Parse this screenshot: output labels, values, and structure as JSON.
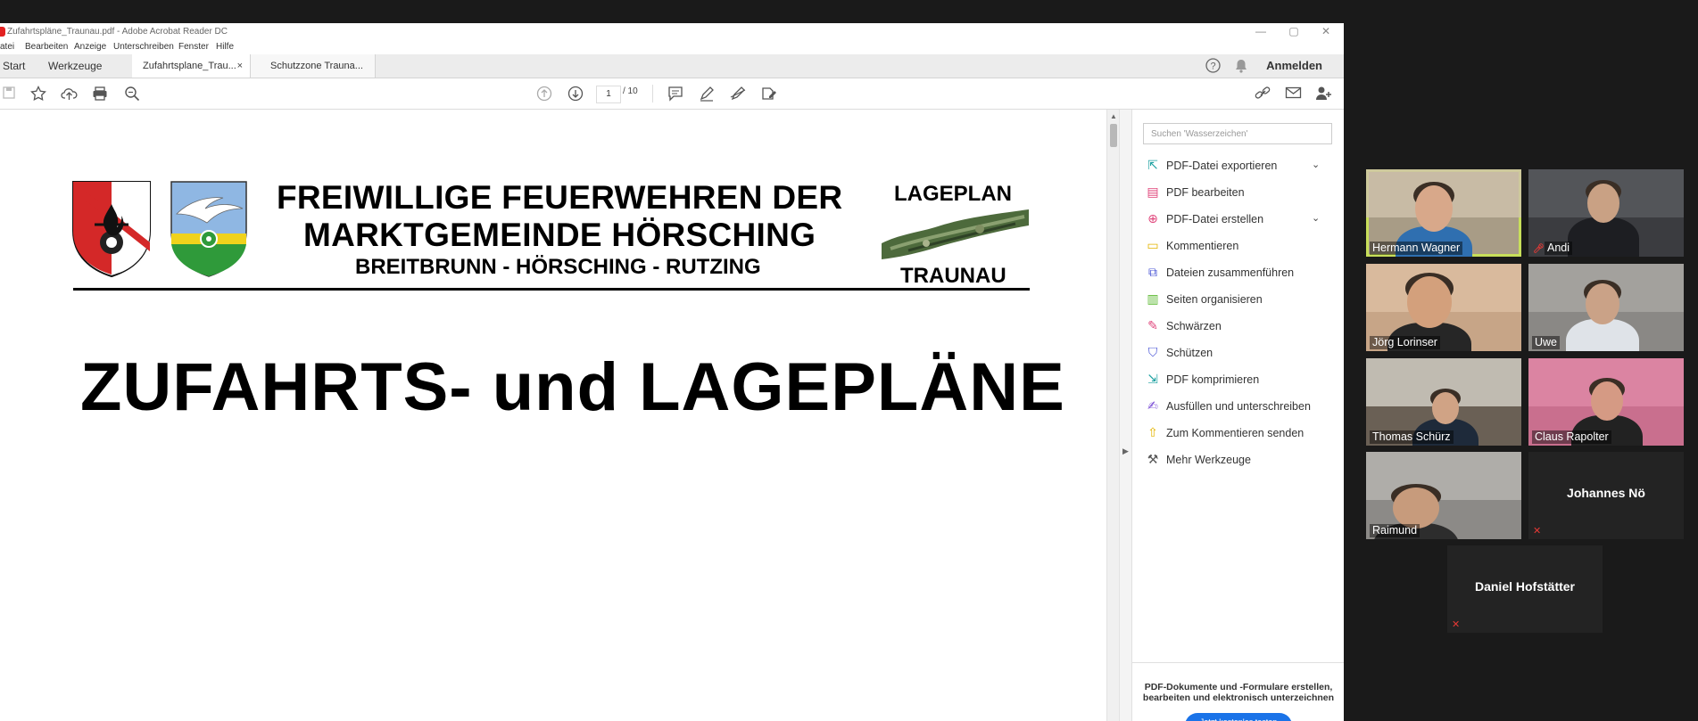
{
  "window": {
    "title": "Zufahrtspläne_Traunau.pdf - Adobe Acrobat Reader DC",
    "minimize": "—",
    "maximize": "▢",
    "close": "✕"
  },
  "menu": [
    "atei",
    "Bearbeiten",
    "Anzeige",
    "Unterschreiben",
    "Fenster",
    "Hilfe"
  ],
  "tabs": {
    "start": "Start",
    "werkzeuge": "Werkzeuge",
    "doc1": "Zufahrtsplane_Trau...",
    "doc2": "Schutzzone Trauna...",
    "close_glyph": "×",
    "sign_in": "Anmelden"
  },
  "toolbar": {
    "page_current": "1",
    "page_total": "/ 10"
  },
  "document": {
    "heading_line1": "FREIWILLIGE FEUERWEHREN DER",
    "heading_line2": "MARKTGEMEINDE HÖRSCHING",
    "heading_line3": "BREITBRUNN - HÖRSCHING - RUTZING",
    "lageplan": "LAGEPLAN",
    "traunau": "TRAUNAU",
    "title": "ZUFAHRTS- und LAGEPLÄNE"
  },
  "tools_pane": {
    "search_placeholder": "Suchen 'Wasserzeichen'",
    "items": [
      {
        "label": "PDF-Datei exportieren",
        "icon": "export-pdf-icon",
        "color": "#1ba0a0",
        "expand": true
      },
      {
        "label": "PDF bearbeiten",
        "icon": "edit-pdf-icon",
        "color": "#e0457b",
        "expand": false
      },
      {
        "label": "PDF-Datei erstellen",
        "icon": "create-pdf-icon",
        "color": "#e0457b",
        "expand": true
      },
      {
        "label": "Kommentieren",
        "icon": "comment-icon",
        "color": "#e3b400",
        "expand": false
      },
      {
        "label": "Dateien zusammenführen",
        "icon": "combine-files-icon",
        "color": "#4a56d6",
        "expand": false
      },
      {
        "label": "Seiten organisieren",
        "icon": "organize-pages-icon",
        "color": "#5ab82f",
        "expand": false
      },
      {
        "label": "Schwärzen",
        "icon": "redact-icon",
        "color": "#e0457b",
        "expand": false
      },
      {
        "label": "Schützen",
        "icon": "protect-icon",
        "color": "#4a56d6",
        "expand": false
      },
      {
        "label": "PDF komprimieren",
        "icon": "compress-pdf-icon",
        "color": "#1ba0a0",
        "expand": false
      },
      {
        "label": "Ausfüllen und unterschreiben",
        "icon": "fill-sign-icon",
        "color": "#7b4fd6",
        "expand": false
      },
      {
        "label": "Zum Kommentieren senden",
        "icon": "send-comment-icon",
        "color": "#e3b400",
        "expand": false
      },
      {
        "label": "Mehr Werkzeuge",
        "icon": "more-tools-icon",
        "color": "#555555",
        "expand": false
      }
    ],
    "promo_text": "PDF-Dokumente und -Formulare erstellen, bearbeiten und elektronisch unterzeichnen",
    "promo_button": "Jetzt kostenlos testen"
  },
  "participants": [
    {
      "name": "Hermann Wagner",
      "muted": false,
      "video": true,
      "active": true
    },
    {
      "name": "Andi",
      "muted": true,
      "video": true,
      "active": false
    },
    {
      "name": "Jörg Lorinser",
      "muted": false,
      "video": true,
      "active": false
    },
    {
      "name": "Uwe",
      "muted": false,
      "video": true,
      "active": false
    },
    {
      "name": "Thomas Schürz",
      "muted": false,
      "video": true,
      "active": false
    },
    {
      "name": "Claus Rapolter",
      "muted": false,
      "video": true,
      "active": false
    },
    {
      "name": "Raimund",
      "muted": false,
      "video": true,
      "active": false
    },
    {
      "name": "Johannes Nö",
      "muted": true,
      "video": false,
      "active": false
    },
    {
      "name": "Daniel Hofstätter",
      "muted": true,
      "video": false,
      "active": false
    }
  ],
  "colors": {
    "accent_blue": "#1a73e8",
    "active_speaker": "#c8df5a",
    "mute_red": "#e53935"
  }
}
